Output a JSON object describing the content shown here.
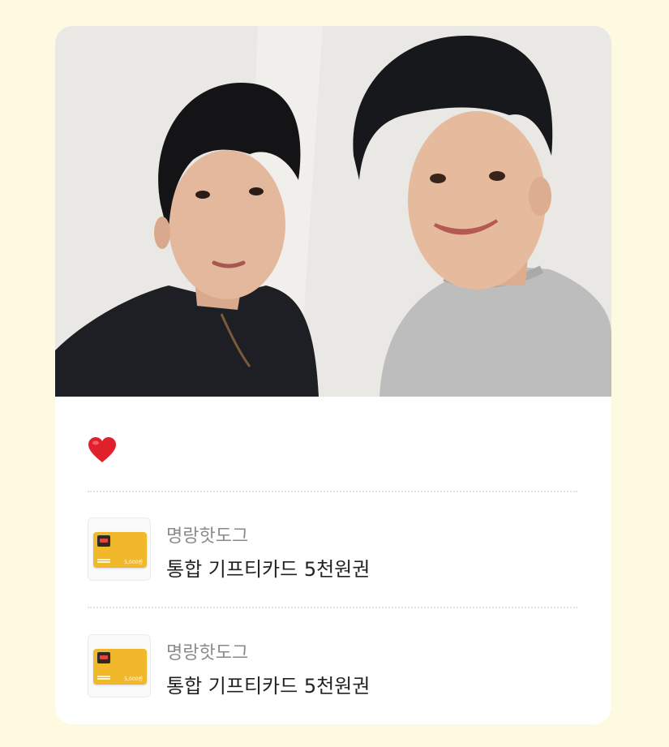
{
  "photo": {
    "description_name": "selfie-photo"
  },
  "message": {
    "emoji": "❤"
  },
  "gifts": [
    {
      "brand": "명랑핫도그",
      "product": "통합 기프티카드 5천원권",
      "card_price": "5,000원"
    },
    {
      "brand": "명랑핫도그",
      "product": "통합 기프티카드 5천원권",
      "card_price": "5,000원"
    }
  ],
  "colors": {
    "background": "#fef9e1",
    "card": "#ffffff",
    "heart": "#e0202a",
    "gift_card": "#f2b82c"
  }
}
